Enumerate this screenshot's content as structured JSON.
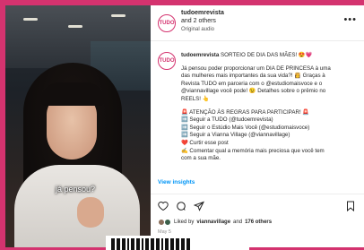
{
  "video": {
    "overlay_text": "já pensou?"
  },
  "header": {
    "avatar_text": "TUDO",
    "username": "tudoemrevista",
    "collaborators": "and 2 others",
    "audio": "Original audio",
    "more_icon": "more-horizontal-icon"
  },
  "caption": {
    "avatar_text": "TUDO",
    "username": "tudoemrevista",
    "title": "SORTEIO DE DIA DAS MÃES! 😍💗",
    "paragraph1": [
      "Já pensou poder proporcionar um DIA DE PRINCESA à uma",
      "das mulheres mais importantes da sua vida?! 👸 Graças à",
      "Revista TUDO em parceria com o @estudiomaisvoce e o",
      "@viannavillage você pode! 😉 Detalhes sobre o prêmio no",
      "REELS! 👆"
    ],
    "rules_title": "🚨 ATENÇÃO ÀS REGRAS PARA PARTICIPAR! 🚨",
    "rules": [
      "➡️ Seguir a TUDO (@tudoemrevista)",
      "➡️ Seguir o Estúdio Mais Você (@estudiomaisvoce)",
      "➡️ Seguir a Vianna Village (@viannavillage)",
      "❤️ Curtir esse post",
      "✍️ Comentar qual a memória mais preciosa que você tem",
      "com a sua mãe."
    ]
  },
  "insights_label": "View insights",
  "likes": {
    "liked_by_prefix": "Liked by",
    "liked_by_user": "viannavillage",
    "and_label": "and",
    "others_count": "176 others"
  },
  "date": "May 5",
  "colors": {
    "brand_pink": "#d4336f",
    "link_blue": "#0095f6",
    "mention_blue": "#00376b"
  },
  "icons": [
    "heart-icon",
    "comment-icon",
    "share-icon",
    "bookmark-icon"
  ]
}
